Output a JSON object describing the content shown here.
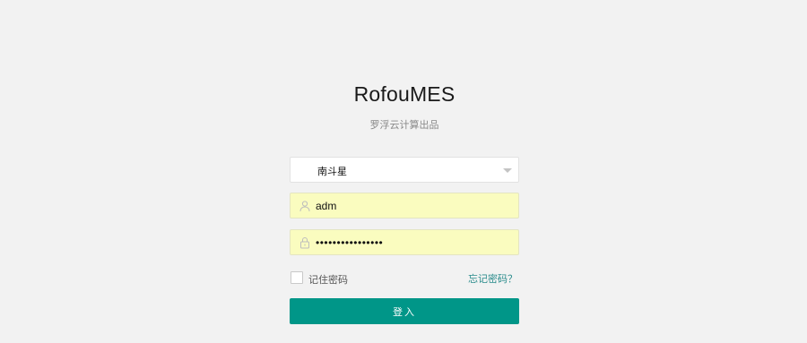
{
  "app": {
    "title": "RofouMES",
    "subtitle": "罗浮云计算出品"
  },
  "form": {
    "tenant_select": {
      "value": "南斗星",
      "icon": "chevron-down-icon"
    },
    "username": {
      "value": "adm",
      "icon": "user-icon"
    },
    "password": {
      "value": "••••••••••••••••",
      "icon": "lock-icon"
    },
    "remember": {
      "label": "记住密码",
      "checked": false
    },
    "forgot_link": "忘记密码？",
    "submit_label": "登入"
  },
  "colors": {
    "background": "#f2f2f2",
    "autofill": "#fafcbf",
    "primary_button": "#009688",
    "link": "#2a8c8c"
  }
}
